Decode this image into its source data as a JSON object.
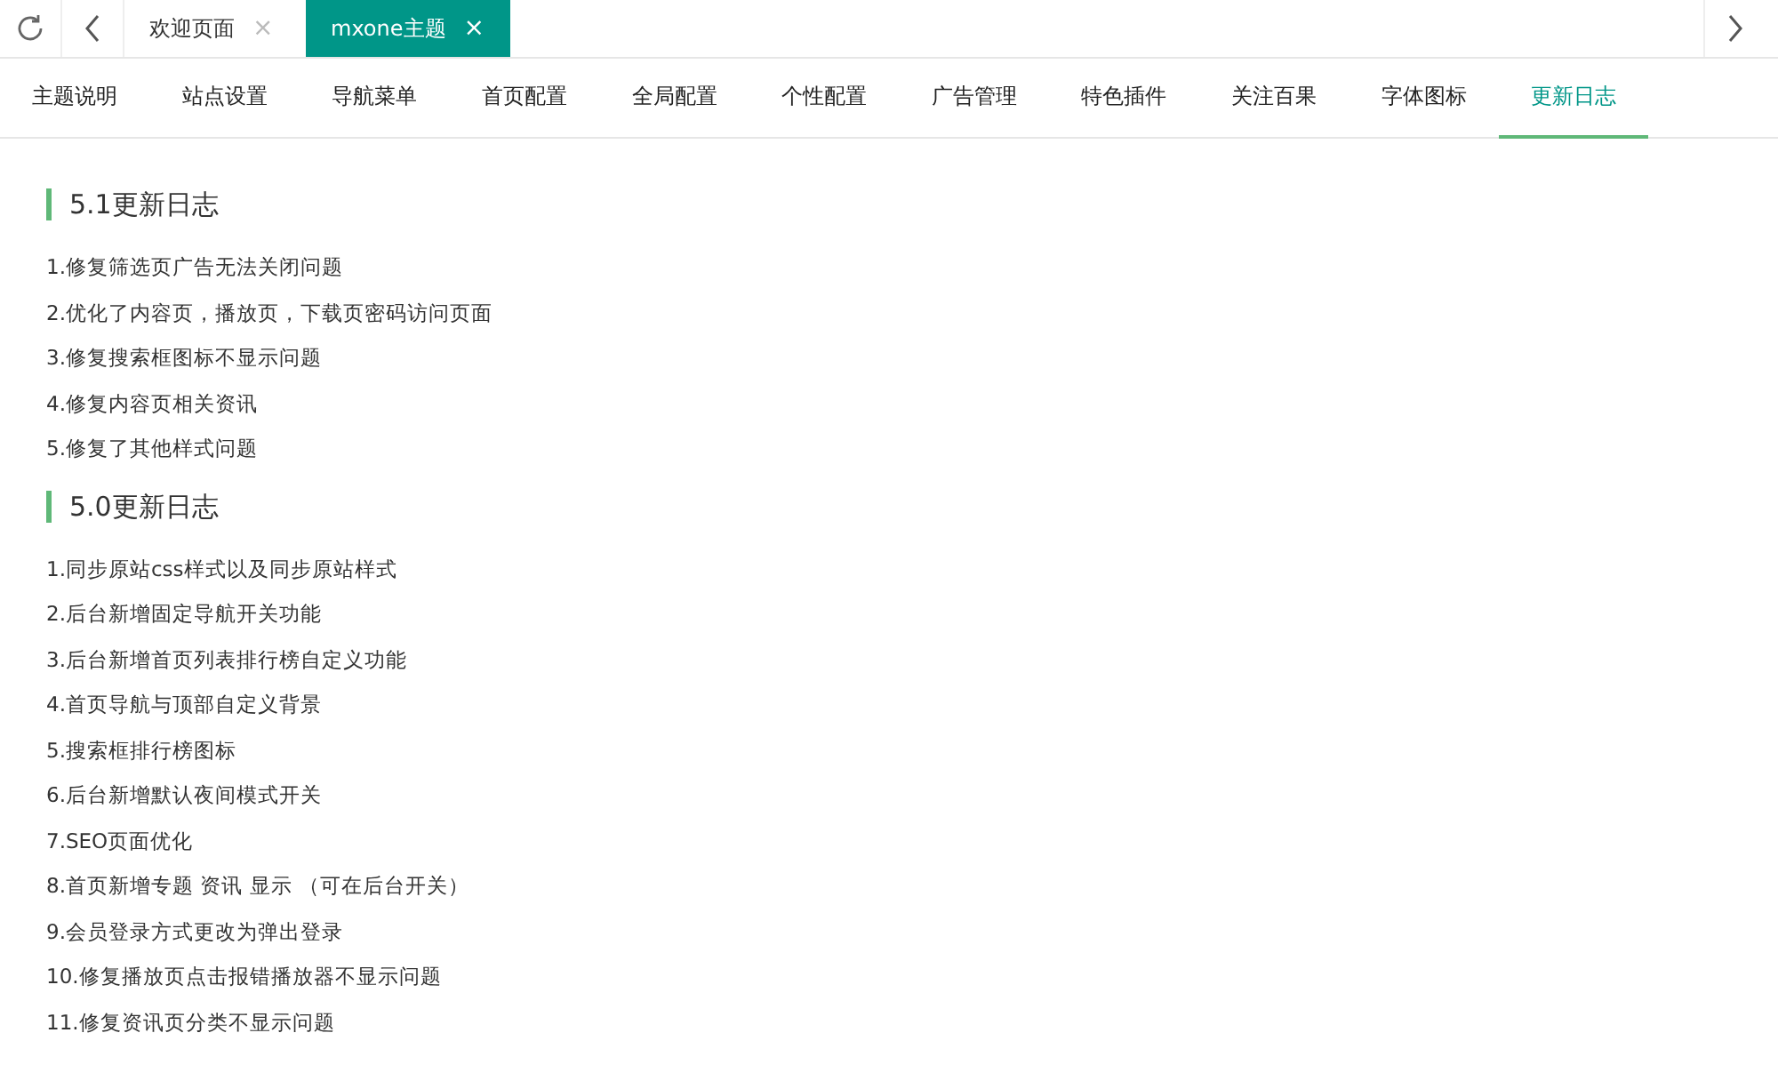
{
  "page_tabs": [
    {
      "label": "欢迎页面",
      "selected": false,
      "close": "×"
    },
    {
      "label": "mxone主题",
      "selected": true,
      "close": "×"
    }
  ],
  "settings_tabs": [
    {
      "label": "主题说明",
      "selected": false
    },
    {
      "label": "站点设置",
      "selected": false
    },
    {
      "label": "导航菜单",
      "selected": false
    },
    {
      "label": "首页配置",
      "selected": false
    },
    {
      "label": "全局配置",
      "selected": false
    },
    {
      "label": "个性配置",
      "selected": false
    },
    {
      "label": "广告管理",
      "selected": false
    },
    {
      "label": "特色插件",
      "selected": false
    },
    {
      "label": "关注百果",
      "selected": false
    },
    {
      "label": "字体图标",
      "selected": false
    },
    {
      "label": "更新日志",
      "selected": true
    }
  ],
  "changelog": [
    {
      "title": "5.1更新日志",
      "items": [
        "1.修复筛选页广告无法关闭问题",
        "2.优化了内容页，播放页，下载页密码访问页面",
        "3.修复搜索框图标不显示问题",
        "4.修复内容页相关资讯",
        "5.修复了其他样式问题"
      ]
    },
    {
      "title": "5.0更新日志",
      "items": [
        "1.同步原站css样式以及同步原站样式",
        "2.后台新增固定导航开关功能",
        "3.后台新增首页列表排行榜自定义功能",
        "4.首页导航与顶部自定义背景",
        "5.搜索框排行榜图标",
        "6.后台新增默认夜间模式开关",
        "7.SEO页面优化",
        "8.首页新增专题 资讯 显示 （可在后台开关）",
        "9.会员登录方式更改为弹出登录",
        "10.修复播放页点击报错播放器不显示问题",
        "11.修复资讯页分类不显示问题"
      ]
    }
  ]
}
